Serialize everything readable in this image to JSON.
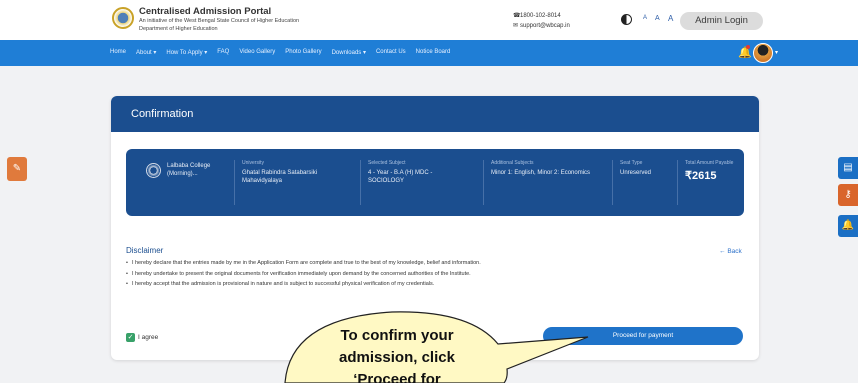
{
  "header": {
    "title": "Centralised Admission Portal",
    "subtitle1": "An initiative of the West Bengal State Council of Higher Education",
    "subtitle2": "Department of Higher Education",
    "phone": "1800-102-8014",
    "email": "support@wbcap.in",
    "font_small": "A",
    "font_medium": "A",
    "font_large": "A",
    "admin_login": "Admin Login"
  },
  "nav": {
    "items": [
      "Home",
      "About ▾",
      "How To Apply ▾",
      "FAQ",
      "Video Gallery",
      "Photo Gallery",
      "Downloads ▾",
      "Contact Us",
      "Notice Board"
    ]
  },
  "card": {
    "title": "Confirmation",
    "college": "Lalbaba College (Morning)...",
    "university_label": "University",
    "university_value": "Ghatal Rabindra Satabarsiki Mahavidyalaya",
    "subject_label": "Selected Subject",
    "subject_value": "4 - Year - B.A (H) MDC - SOCIOLOGY",
    "additional_label": "Additional Subjects",
    "additional_value": "Minor 1: English, Minor 2: Economics",
    "seat_label": "Seat Type",
    "seat_value": "Unreserved",
    "amount_label": "Total Amount Payable",
    "amount_value": "₹2615",
    "disclaimer_title": "Disclaimer",
    "back": "Back",
    "disclaimers": [
      "I hereby declare that the entries made by me in the Application Form are complete and true to the best of my knowledge, belief and information.",
      "I hereby undertake to present the original documents for verification immediately upon demand by the concerned authorities of the Institute.",
      "I hereby accept that the admission is provisional in nature and is subject to successful physical verification of my credentials."
    ],
    "agree_label": "I agree",
    "proceed_label": "Proceed for payment"
  },
  "callout": {
    "line1": "To confirm your",
    "line2": "admission, click",
    "line3": "‘Proceed for"
  },
  "colors": {
    "nav": "#1f7ed6",
    "card_header": "#1b4e8f",
    "button": "#1f73c9",
    "checkbox": "#38a169",
    "side_widget": "#e07a3c"
  },
  "icons": [
    "logo",
    "phone-icon",
    "mail-icon",
    "contrast-icon",
    "bell-icon",
    "avatar",
    "feedback-icon",
    "id-card-icon",
    "key-icon",
    "notification-icon",
    "back-arrow-icon",
    "check-icon"
  ]
}
